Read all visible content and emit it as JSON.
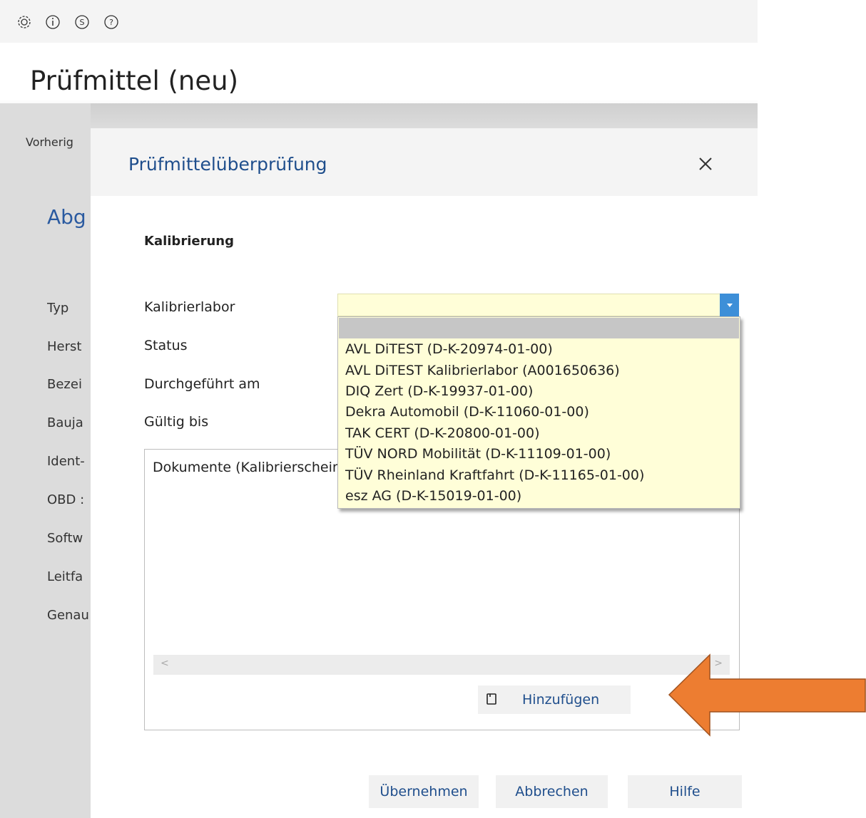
{
  "topbar": {
    "icons": [
      "settings-icon",
      "info-icon",
      "s-icon",
      "help-icon"
    ]
  },
  "page": {
    "title": "Prüfmittel (neu)",
    "toolbar": {
      "previous_label": "Vorherig",
      "icons": [
        "previous-icon",
        "next-icon",
        "print-icon",
        "new-icon",
        "edit-icon",
        "save-icon",
        "cancel-icon",
        "delete-icon"
      ]
    },
    "section_heading": "Abg",
    "labels": [
      "Typ",
      "Herst",
      "Bezei",
      "Bauja",
      "Ident-",
      "OBD :",
      "Softw",
      "Leitfa",
      "Genau"
    ]
  },
  "dialog": {
    "title": "Prüfmittelüberprüfung",
    "group_title": "Kalibrierung",
    "fields": {
      "lab": "Kalibrierlabor",
      "status": "Status",
      "performed": "Durchgeführt am",
      "valid_until": "Gültig bis"
    },
    "combo_value": "",
    "documents_label": "Dokumente (Kalibrierscheine)",
    "add_button": "Hinzufügen",
    "footer": {
      "apply": "Übernehmen",
      "cancel": "Abbrechen",
      "help": "Hilfe"
    }
  },
  "dropdown": {
    "options": [
      "AVL DiTEST (D-K-20974-01-00)",
      "AVL DiTEST Kalibrierlabor  (A001650636)",
      "DIQ Zert (D-K-19937-01-00)",
      "Dekra Automobil (D-K-11060-01-00)",
      "TAK CERT (D-K-20800-01-00)",
      "TÜV NORD Mobilität (D-K-11109-01-00)",
      "TÜV Rheinland Kraftfahrt (D-K-11165-01-00)",
      "esz AG (D-K-15019-01-00)"
    ]
  },
  "colors": {
    "accent": "#1f4e8c",
    "combo_bg": "#fffed8",
    "combo_arrow": "#3d8fd8",
    "arrow": "#ed7d31"
  }
}
